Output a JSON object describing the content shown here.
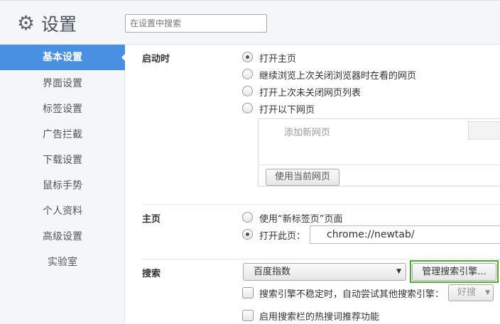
{
  "header": {
    "title": "设置",
    "search_placeholder": "在设置中搜索"
  },
  "sidebar": {
    "items": [
      {
        "label": "基本设置"
      },
      {
        "label": "界面设置"
      },
      {
        "label": "标签设置"
      },
      {
        "label": "广告拦截"
      },
      {
        "label": "下载设置"
      },
      {
        "label": "鼠标手势"
      },
      {
        "label": "个人资料"
      },
      {
        "label": "高级设置"
      },
      {
        "label": "实验室"
      }
    ]
  },
  "startup": {
    "label": "启动时",
    "options": [
      "打开主页",
      "继续浏览上次关闭浏览器时在看的网页",
      "打开上次未关闭网页列表",
      "打开以下网页"
    ],
    "add_page": "添加新网页",
    "use_current": "使用当前网页"
  },
  "home": {
    "label": "主页",
    "options": [
      "使用“新标签页”页面",
      "打开此页："
    ],
    "url": "chrome://newtab/"
  },
  "search": {
    "label": "搜索",
    "engine": "百度指数",
    "manage": "管理搜索引擎...",
    "fallback_label": "搜索引擎不稳定时，自动尝试其他搜索引擎：",
    "fallback_engine": "好搜",
    "hot_words": "启用搜索栏的热搜词推荐功能"
  },
  "colors": {
    "accent": "#4a90e2",
    "highlight": "#4caf2a"
  }
}
